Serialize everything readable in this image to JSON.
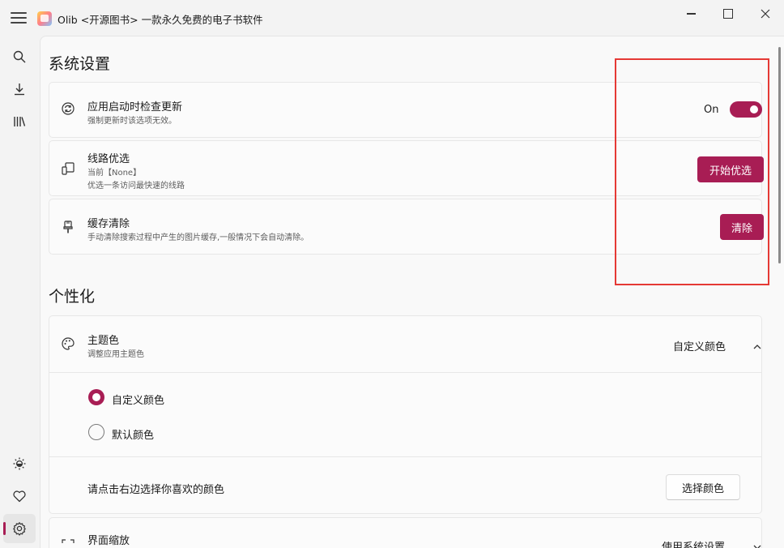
{
  "window": {
    "title": "Olib <开源图书> 一款永久免费的电子书软件"
  },
  "nav": {
    "items": [
      {
        "icon": "search-icon"
      },
      {
        "icon": "download-icon"
      },
      {
        "icon": "library-icon"
      },
      {
        "icon": "theme-icon"
      },
      {
        "icon": "heart-icon"
      },
      {
        "icon": "settings-icon"
      }
    ],
    "active": "settings"
  },
  "system": {
    "title": "系统设置",
    "update": {
      "title": "应用启动时检查更新",
      "desc": "强制更新时该选项无效。",
      "toggle_label": "On",
      "toggle_on": true
    },
    "route": {
      "title": "线路优选",
      "current": "当前【None】",
      "desc": "优选一条访问最快速的线路",
      "button": "开始优选"
    },
    "cache": {
      "title": "缓存清除",
      "desc": "手动清除搜索过程中产生的图片缓存,一般情况下会自动清除。",
      "button": "清除"
    }
  },
  "personal": {
    "title": "个性化",
    "theme": {
      "title": "主题色",
      "desc": "调整应用主题色",
      "value": "自定义颜色",
      "options": [
        "自定义颜色",
        "默认颜色"
      ],
      "selected": "自定义颜色",
      "pick_prompt": "请点击右边选择你喜欢的颜色",
      "pick_button": "选择颜色"
    },
    "zoom": {
      "title": "界面缩放",
      "value": "使用系统设置"
    }
  },
  "colors": {
    "accent": "#a81d54",
    "highlight": "#e53935"
  }
}
